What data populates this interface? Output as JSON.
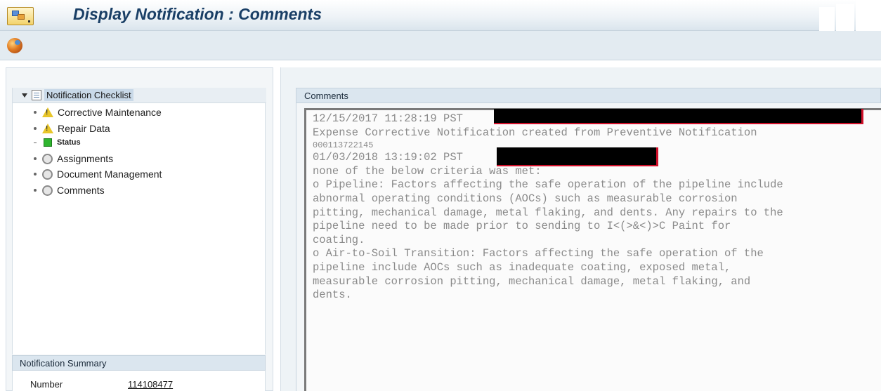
{
  "window": {
    "title": "Display Notification :  Comments"
  },
  "icons": {
    "app": "transaction-icon",
    "toolbar": "globe-services-icon",
    "warning": "warning-triangle-icon",
    "status": "green-square-icon",
    "pending": "gray-circle-icon"
  },
  "checklist": {
    "root_label": "Notification Checklist",
    "items": [
      {
        "label": "Corrective Maintenance",
        "icon": "warning-triangle-icon"
      },
      {
        "label": "Repair Data",
        "icon": "warning-triangle-icon"
      },
      {
        "label": "Status",
        "icon": "green-square-icon"
      },
      {
        "label": "Assignments",
        "icon": "gray-circle-icon"
      },
      {
        "label": "Document Management",
        "icon": "gray-circle-icon"
      },
      {
        "label": "Comments",
        "icon": "gray-circle-icon"
      }
    ]
  },
  "summary": {
    "header": "Notification Summary",
    "number_label": "Number",
    "number_value": "114108477"
  },
  "comments": {
    "header": "Comments",
    "lines": [
      "12/15/2017 11:28:19 PST",
      "Expense Corrective Notification created from Preventive Notification",
      "000113722145",
      "01/03/2018 13:19:02 PST",
      "none of the below criteria was met:",
      "o Pipeline: Factors affecting the safe operation of the pipeline include",
      "abnormal operating conditions (AOCs) such as measurable corrosion",
      "pitting, mechanical damage, metal flaking, and dents. Any repairs to the",
      "pipeline need to be made prior to sending to I<(>&<)>C Paint for",
      "coating.",
      "o Air-to-Soil Transition: Factors affecting the safe operation of the",
      "pipeline include AOCs such as inadequate coating, exposed metal,",
      "measurable corrosion pitting, mechanical damage, metal flaking, and",
      "dents."
    ]
  },
  "colors": {
    "title_text": "#1a3f66",
    "redaction_border": "#d0102a",
    "comment_text": "#8a8a8a"
  }
}
